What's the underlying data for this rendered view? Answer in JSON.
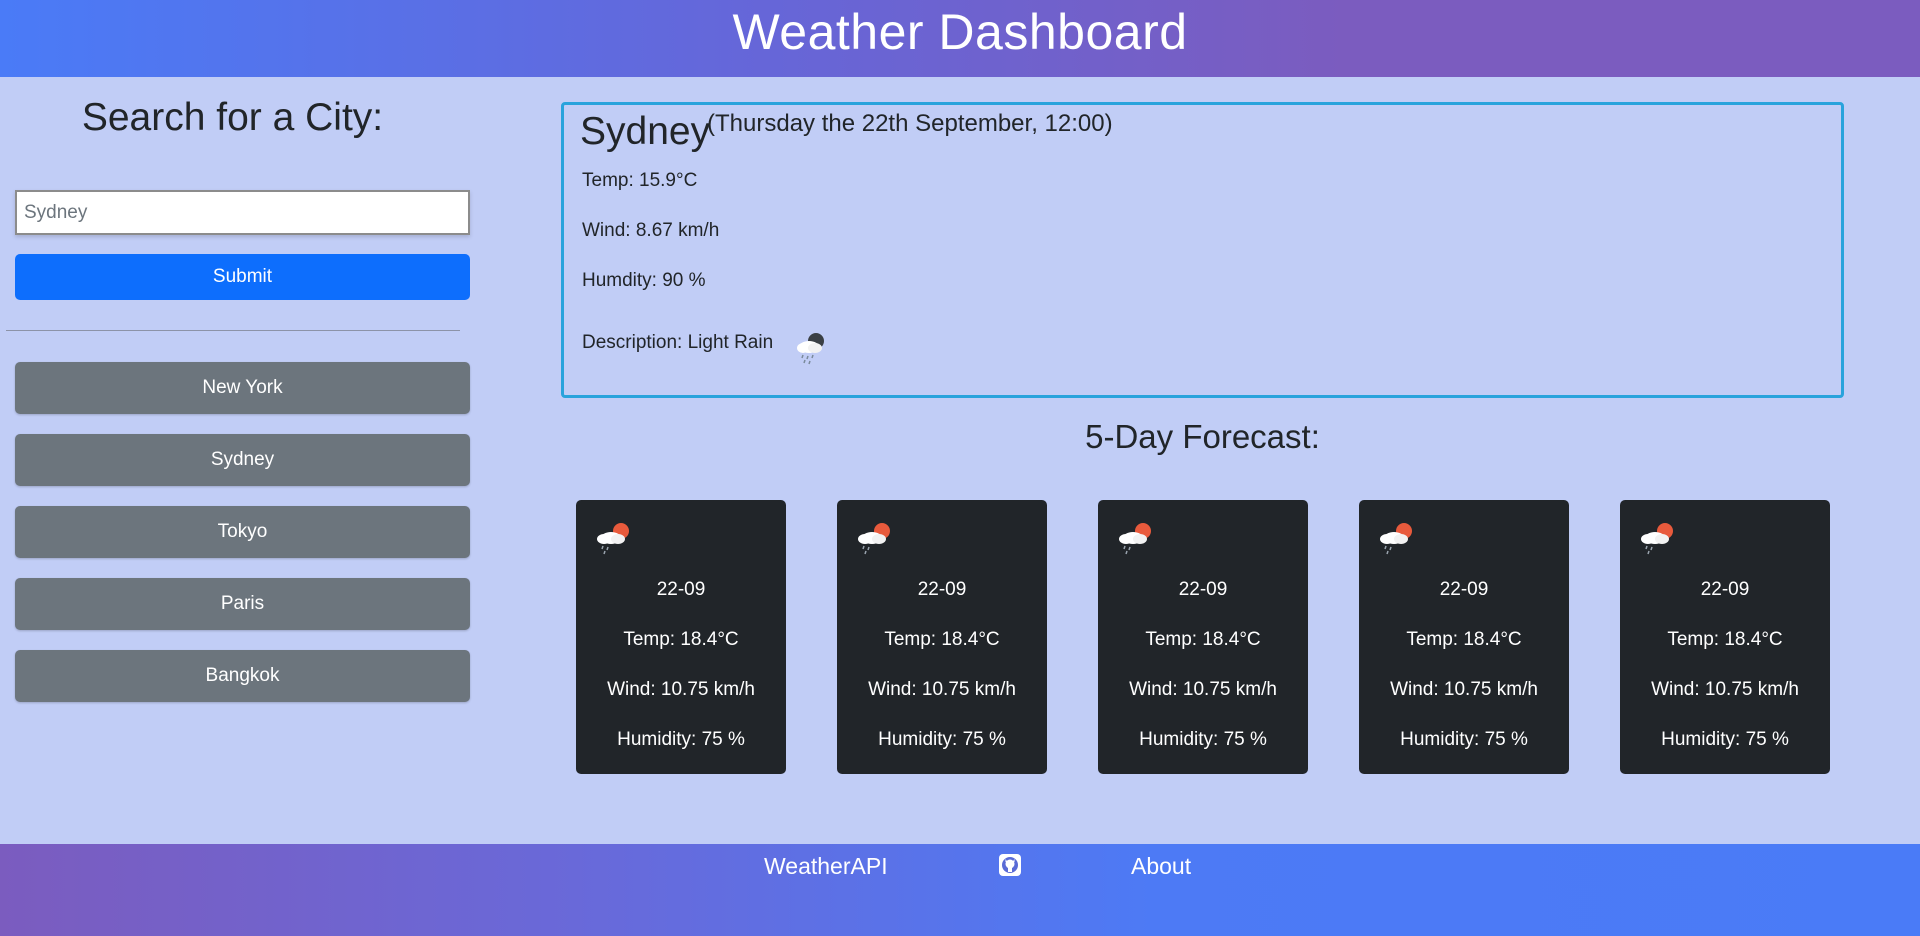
{
  "header": {
    "title": "Weather Dashboard"
  },
  "search": {
    "title": "Search for a City:",
    "input_placeholder": "Sydney",
    "input_value": "",
    "submit_label": "Submit"
  },
  "history": [
    "New York",
    "Sydney",
    "Tokyo",
    "Paris",
    "Bangkok"
  ],
  "current": {
    "city": "Sydney",
    "date": "(Thursday the 22th September, 12:00)",
    "temp": "Temp: 15.9°C",
    "wind": "Wind: 8.67 km/h",
    "humidity": "Humdity: 90 %",
    "description": "Description: Light Rain",
    "icon": "light-rain-icon"
  },
  "forecast": {
    "title": "5-Day Forecast:",
    "days": [
      {
        "date": "22-09",
        "temp": "Temp: 18.4°C",
        "wind": "Wind: 10.75 km/h",
        "humidity": "Humidity: 75 %",
        "icon": "sun-cloud-rain-icon"
      },
      {
        "date": "22-09",
        "temp": "Temp: 18.4°C",
        "wind": "Wind: 10.75 km/h",
        "humidity": "Humidity: 75 %",
        "icon": "sun-cloud-rain-icon"
      },
      {
        "date": "22-09",
        "temp": "Temp: 18.4°C",
        "wind": "Wind: 10.75 km/h",
        "humidity": "Humidity: 75 %",
        "icon": "sun-cloud-rain-icon"
      },
      {
        "date": "22-09",
        "temp": "Temp: 18.4°C",
        "wind": "Wind: 10.75 km/h",
        "humidity": "Humidity: 75 %",
        "icon": "sun-cloud-rain-icon"
      },
      {
        "date": "22-09",
        "temp": "Temp: 18.4°C",
        "wind": "Wind: 10.75 km/h",
        "humidity": "Humidity: 75 %",
        "icon": "sun-cloud-rain-icon"
      }
    ]
  },
  "footer": {
    "weather_api_label": "WeatherAPI",
    "github_icon": "github-icon",
    "about_label": "About"
  },
  "colors": {
    "background": "#c1cdf6",
    "primary_button": "#0d6efd",
    "history_button": "#6c757d",
    "card": "#212529",
    "current_border": "#29a3dc"
  }
}
